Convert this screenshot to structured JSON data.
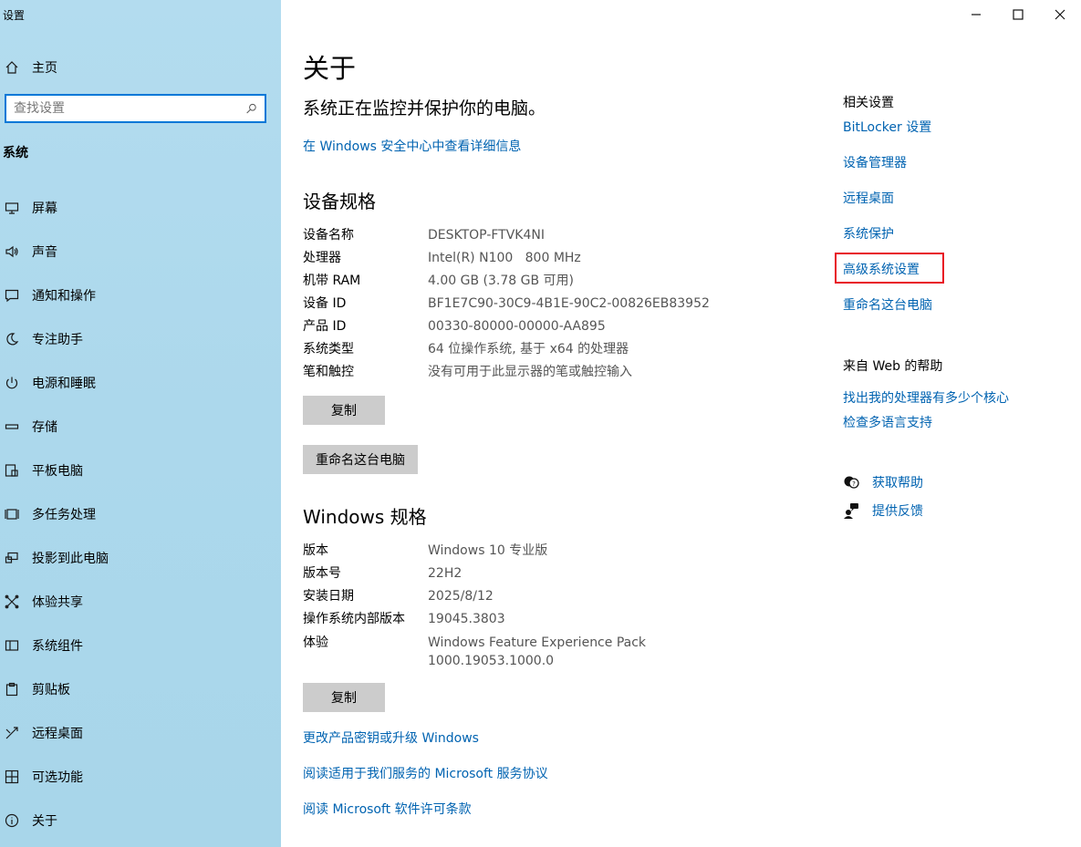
{
  "app": {
    "title": "设置"
  },
  "window_controls": {
    "minimize": "minimize-icon",
    "maximize": "maximize-icon",
    "close": "close-icon"
  },
  "sidebar": {
    "home_label": "主页",
    "search_placeholder": "查找设置",
    "section_label": "系统",
    "items": [
      {
        "label": "屏幕",
        "icon": "monitor-icon"
      },
      {
        "label": "声音",
        "icon": "speaker-icon"
      },
      {
        "label": "通知和操作",
        "icon": "notification-icon"
      },
      {
        "label": "专注助手",
        "icon": "moon-icon"
      },
      {
        "label": "电源和睡眠",
        "icon": "power-icon"
      },
      {
        "label": "存储",
        "icon": "storage-icon"
      },
      {
        "label": "平板电脑",
        "icon": "tablet-icon"
      },
      {
        "label": "多任务处理",
        "icon": "multitask-icon"
      },
      {
        "label": "投影到此电脑",
        "icon": "project-icon"
      },
      {
        "label": "体验共享",
        "icon": "share-icon"
      },
      {
        "label": "系统组件",
        "icon": "components-icon"
      },
      {
        "label": "剪贴板",
        "icon": "clipboard-icon"
      },
      {
        "label": "远程桌面",
        "icon": "remote-icon"
      },
      {
        "label": "可选功能",
        "icon": "features-icon"
      },
      {
        "label": "关于",
        "icon": "info-icon"
      }
    ]
  },
  "main": {
    "title": "关于",
    "protection_text": "系统正在监控并保护你的电脑。",
    "security_link": "在 Windows 安全中心中查看详细信息",
    "device_specs": {
      "heading": "设备规格",
      "rows": [
        {
          "key": "设备名称",
          "value": "DESKTOP-FTVK4NI"
        },
        {
          "key": "处理器",
          "value": "Intel(R) N100   800 MHz"
        },
        {
          "key": "机带 RAM",
          "value": "4.00 GB (3.78 GB 可用)"
        },
        {
          "key": "设备 ID",
          "value": "BF1E7C90-30C9-4B1E-90C2-00826EB83952"
        },
        {
          "key": "产品 ID",
          "value": "00330-80000-00000-AA895"
        },
        {
          "key": "系统类型",
          "value": "64 位操作系统, 基于 x64 的处理器"
        },
        {
          "key": "笔和触控",
          "value": "没有可用于此显示器的笔或触控输入"
        }
      ],
      "copy_button": "复制",
      "rename_button": "重命名这台电脑"
    },
    "windows_specs": {
      "heading": "Windows 规格",
      "rows": [
        {
          "key": "版本",
          "value": "Windows 10 专业版"
        },
        {
          "key": "版本号",
          "value": "22H2"
        },
        {
          "key": "安装日期",
          "value": "2025/8/12"
        },
        {
          "key": "操作系统内部版本",
          "value": "19045.3803"
        },
        {
          "key": "体验",
          "value": "Windows Feature Experience Pack",
          "value2": "1000.19053.1000.0"
        }
      ],
      "copy_button": "复制"
    },
    "bottom_links": [
      "更改产品密钥或升级 Windows",
      "阅读适用于我们服务的 Microsoft 服务协议",
      "阅读 Microsoft 软件许可条款"
    ]
  },
  "right": {
    "related_heading": "相关设置",
    "related_links": [
      "BitLocker 设置",
      "设备管理器",
      "远程桌面",
      "系统保护",
      "高级系统设置",
      "重命名这台电脑"
    ],
    "web_help_heading": "来自 Web 的帮助",
    "web_help_links": [
      "找出我的处理器有多少个核心",
      "检查多语言支持"
    ],
    "get_help": "获取帮助",
    "feedback": "提供反馈"
  },
  "colors": {
    "link": "#0063b1",
    "highlight": "#e81123",
    "sidebar": "#acd8ec",
    "button": "#cccccc"
  }
}
